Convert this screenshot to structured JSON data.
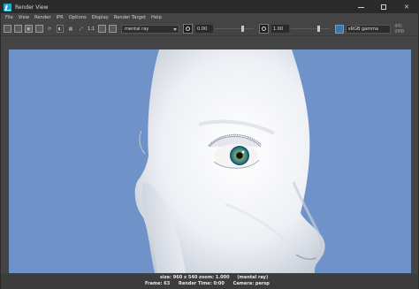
{
  "window": {
    "title": "Render View"
  },
  "menu": {
    "items": [
      "File",
      "View",
      "Render",
      "IPR",
      "Options",
      "Display",
      "Render Target",
      "Help"
    ]
  },
  "toolbar": {
    "ratio_label": "1:1",
    "renderer": "mental ray",
    "exposure_value": "0.00",
    "gamma_value": "1.00",
    "color_space": "sRGB gamma",
    "ipr_memory": "IPR: 0MB"
  },
  "colors": {
    "viewport_background": "#6f93c9",
    "accent_green": "#35a53a",
    "accent_blue": "#3d77a6"
  },
  "status": {
    "size_info": "size: 960 x 540  zoom: 1.000",
    "renderer_info": "(mental ray)",
    "frame": "Frame: 63",
    "render_time": "Render Time: 0:00",
    "camera": "Camera: persp"
  },
  "icons": [
    "render-frame-icon",
    "render-region-icon",
    "snapshot-icon",
    "ipr-icon",
    "refresh-icon",
    "rgb-channels-icon",
    "zoom-icon",
    "ratio-icon",
    "keep-image-icon",
    "remove-image-icon",
    "exposure-icon",
    "gamma-icon",
    "color-management-icon"
  ]
}
